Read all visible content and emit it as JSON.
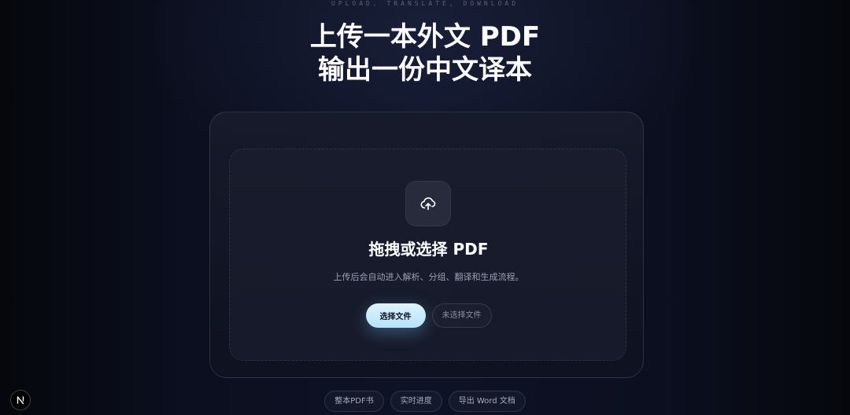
{
  "header": {
    "eyebrow": "UPLOAD, TRANSLATE, DOWNLOAD",
    "title_line1": "上传一本外文 PDF",
    "title_line2": "输出一份中文译本"
  },
  "upload": {
    "icon": "cloud-upload-icon",
    "title": "拖拽或选择 PDF",
    "description": "上传后会自动进入解析、分组、翻译和生成流程。",
    "choose_button_label": "选择文件",
    "file_status": "未选择文件"
  },
  "features": [
    {
      "label": "整本PDF书"
    },
    {
      "label": "实时进度"
    },
    {
      "label": "导出 Word 文档"
    }
  ],
  "dev_badge": {
    "icon": "next-logo-icon",
    "letter": "N"
  },
  "colors": {
    "background": "#0b0f1f",
    "primary_button": "#c8ebff",
    "text_muted": "#9aa0b4"
  }
}
